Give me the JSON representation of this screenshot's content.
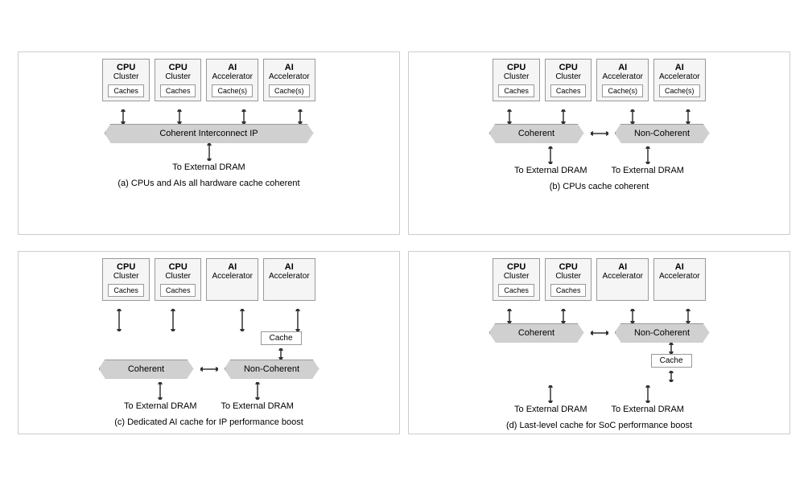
{
  "diagrams": {
    "a": {
      "caption": "(a) CPUs and AIs all hardware cache coherent",
      "units": [
        {
          "title": "CPU",
          "sub": "Cluster",
          "cache": "Caches"
        },
        {
          "title": "CPU",
          "sub": "Cluster",
          "cache": "Caches"
        },
        {
          "title": "AI",
          "sub": "Accelerator",
          "cache": "Cache(s)"
        },
        {
          "title": "AI",
          "sub": "Accelerator",
          "cache": "Cache(s)"
        }
      ],
      "interconnect": "Coherent Interconnect IP",
      "dram_labels": [
        "To External DRAM"
      ]
    },
    "b": {
      "caption": "(b) CPUs cache coherent",
      "units": [
        {
          "title": "CPU",
          "sub": "Cluster",
          "cache": "Caches"
        },
        {
          "title": "CPU",
          "sub": "Cluster",
          "cache": "Caches"
        },
        {
          "title": "AI",
          "sub": "Accelerator",
          "cache": "Cache(s)"
        },
        {
          "title": "AI",
          "sub": "Accelerator",
          "cache": "Cache(s)"
        }
      ],
      "interconnect_left": "Coherent",
      "interconnect_right": "Non-Coherent",
      "dram_labels": [
        "To External DRAM",
        "To External DRAM"
      ]
    },
    "c": {
      "caption": "(c) Dedicated AI cache for IP performance boost",
      "units": [
        {
          "title": "CPU",
          "sub": "Cluster",
          "cache": "Caches"
        },
        {
          "title": "CPU",
          "sub": "Cluster",
          "cache": "Caches"
        },
        {
          "title": "AI",
          "sub": "Accelerator",
          "cache": null
        },
        {
          "title": "AI",
          "sub": "Accelerator",
          "cache": null
        }
      ],
      "cache_extra": "Cache",
      "interconnect_left": "Coherent",
      "interconnect_right": "Non-Coherent",
      "dram_labels": [
        "To External DRAM",
        "To External DRAM"
      ]
    },
    "d": {
      "caption": "(d) Last-level cache for SoC performance boost",
      "units": [
        {
          "title": "CPU",
          "sub": "Cluster",
          "cache": "Caches"
        },
        {
          "title": "CPU",
          "sub": "Cluster",
          "cache": "Caches"
        },
        {
          "title": "AI",
          "sub": "Accelerator",
          "cache": null
        },
        {
          "title": "AI",
          "sub": "Accelerator",
          "cache": null
        }
      ],
      "cache_extra": "Cache",
      "interconnect_left": "Coherent",
      "interconnect_right": "Non-Coherent",
      "dram_labels": [
        "To External DRAM",
        "To External DRAM"
      ]
    }
  }
}
